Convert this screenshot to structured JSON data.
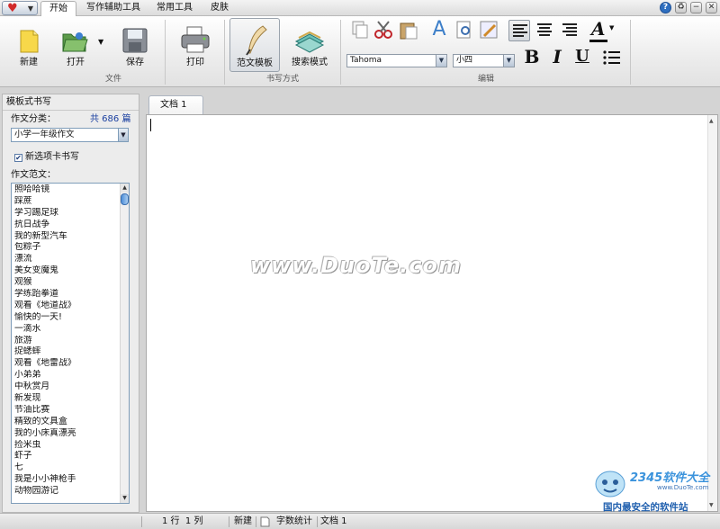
{
  "tabs": [
    {
      "label": "开始",
      "active": true
    },
    {
      "label": "写作辅助工具",
      "active": false
    },
    {
      "label": "常用工具",
      "active": false
    },
    {
      "label": "皮肤",
      "active": false
    }
  ],
  "window_controls": {
    "help": "?",
    "skin": "♻",
    "minimize": "−",
    "close": "✕"
  },
  "ribbon": {
    "file_group": {
      "label": "文件",
      "new": "新建",
      "open": "打开",
      "save": "保存",
      "print": "打印"
    },
    "mode_group": {
      "label": "书写方式",
      "template": "范文模板",
      "search": "搜索模式"
    },
    "edit_group": {
      "label": "编辑",
      "font_name": "Tahoma",
      "font_size": "小四",
      "bold": "B",
      "italic": "I",
      "underline": "U",
      "font_color_letter": "A"
    }
  },
  "left_panel": {
    "title": "模板式书写",
    "category_label": "作文分类：",
    "total_count": "共 686 篇",
    "category_value": "小学一年级作文",
    "newtab_label": "新选项卡书写",
    "newtab_checked": "✔",
    "list_label": "作文范文：",
    "essays": [
      "照哈哈镜",
      "踩蔗",
      "学习踢足球",
      "抗日战争",
      "我的新型汽车",
      "包粽子",
      "漂流",
      "美女变魔鬼",
      "观猴",
      "学练跆拳道",
      "观看《地道战》",
      "愉快的一天!",
      "一滴水",
      "旅游",
      "捉蟋蟀",
      "观看《地雷战》",
      "小弟弟",
      "中秋赏月",
      "新发现",
      "节油比赛",
      "精致的文具盒",
      "我的小床真漂亮",
      "捡米虫",
      "虾子",
      "七",
      "我是小小神枪手",
      "动物园游记"
    ]
  },
  "document": {
    "tab_label": "文档 1",
    "watermark": "www.DuoTe.com"
  },
  "status_bar": {
    "position": "1 行  1 列",
    "mode": "新建",
    "word_count": "字数统计",
    "doc": "文档 1"
  },
  "corner_logo": {
    "brand": "2345软件大全",
    "url": "www.DuoTe.com",
    "slogan": "国内最安全的软件站"
  },
  "colors": {
    "accent_red": "#d12a2a",
    "accent_blue": "#2f6fc0",
    "font_color_bar": "#111111"
  }
}
